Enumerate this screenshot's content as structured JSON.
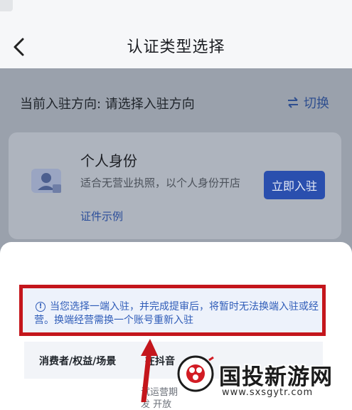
{
  "header": {
    "title": "认证类型选择",
    "back_icon": "chevron-left-icon"
  },
  "direction": {
    "label": "当前入驻方向: 请选择入驻方向",
    "switch_label": "切换",
    "switch_icon": "swap-arrows-icon"
  },
  "card": {
    "title": "个人身份",
    "description": "适合无营业执照，以个人身份开店",
    "link": "证件示例",
    "button": "立即入驻",
    "icon": "person-id-icon"
  },
  "notice": {
    "line1": "当您选择一端入驻，并完成提审后，将暂时无法换端入驻或经",
    "line2": "营。换端经营需换一个账号重新入驻",
    "icon": "info-icon"
  },
  "table": {
    "col1": "消费者/权益/场景",
    "col2": "在抖音",
    "row_line1": "试运营期",
    "row_line2": "发 开放"
  },
  "watermark": {
    "brand": "国投新游网",
    "url": "www.sxsgytr.com"
  },
  "colors": {
    "accent": "#2a4fae",
    "highlight": "#c4161c",
    "overlay": "#9aa1ac"
  }
}
